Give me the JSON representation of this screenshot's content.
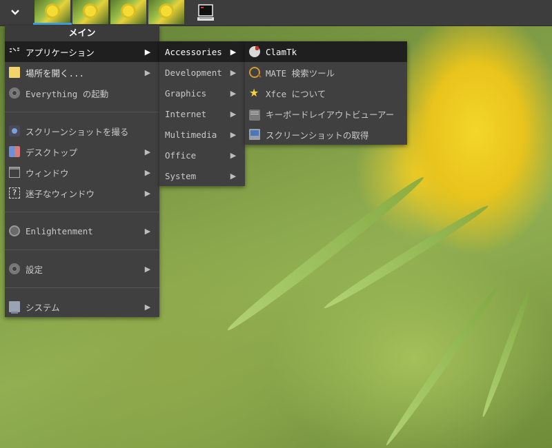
{
  "panel": {
    "menu_toggle_icon": "chevron-down-icon",
    "tasks": [
      {
        "name": "flower-wallpaper-thumbnail"
      },
      {
        "name": "flower-wallpaper-thumbnail"
      },
      {
        "name": "flower-wallpaper-thumbnail"
      },
      {
        "name": "flower-wallpaper-thumbnail"
      }
    ],
    "terminal_icon": "terminal-icon"
  },
  "main_menu": {
    "title": "メイン",
    "items": [
      {
        "label": "アプリケーション",
        "icon": "applications-icon",
        "submenu": true,
        "active": true
      },
      {
        "label": "場所を開く...",
        "icon": "folder-icon",
        "submenu": true
      },
      {
        "label": "Everything の起動",
        "icon": "gear-icon",
        "submenu": false
      },
      {
        "label": "スクリーンショットを撮る",
        "icon": "camera-icon",
        "submenu": false
      },
      {
        "label": "デスクトップ",
        "icon": "desktop-icon",
        "submenu": true
      },
      {
        "label": "ウィンドウ",
        "icon": "window-icon",
        "submenu": true
      },
      {
        "label": "迷子なウィンドウ",
        "icon": "lost-window-icon",
        "submenu": true
      },
      {
        "label": "Enlightenment",
        "icon": "enlightenment-icon",
        "submenu": true
      },
      {
        "label": "設定",
        "icon": "settings-gear-icon",
        "submenu": true
      },
      {
        "label": "システム",
        "icon": "system-icon",
        "submenu": true
      }
    ]
  },
  "apps_menu": {
    "items": [
      {
        "label": "Accessories",
        "active": true
      },
      {
        "label": "Development"
      },
      {
        "label": "Graphics"
      },
      {
        "label": "Internet"
      },
      {
        "label": "Multimedia"
      },
      {
        "label": "Office"
      },
      {
        "label": "System"
      }
    ]
  },
  "accessories_menu": {
    "items": [
      {
        "label": "ClamTk",
        "icon": "clamtk-icon",
        "active": true
      },
      {
        "label": "MATE 検索ツール",
        "icon": "magnifier-icon"
      },
      {
        "label": "Xfce について",
        "icon": "star-icon"
      },
      {
        "label": "キーボードレイアウトビューアー",
        "icon": "keyboard-icon"
      },
      {
        "label": "スクリーンショットの取得",
        "icon": "screenshot-icon"
      }
    ]
  },
  "colors": {
    "panel_bg": "#3d3d3d",
    "menu_bg": "#404040",
    "active_item_bg": "#1f1f1f",
    "task_indicator": "#3ca2e0"
  }
}
